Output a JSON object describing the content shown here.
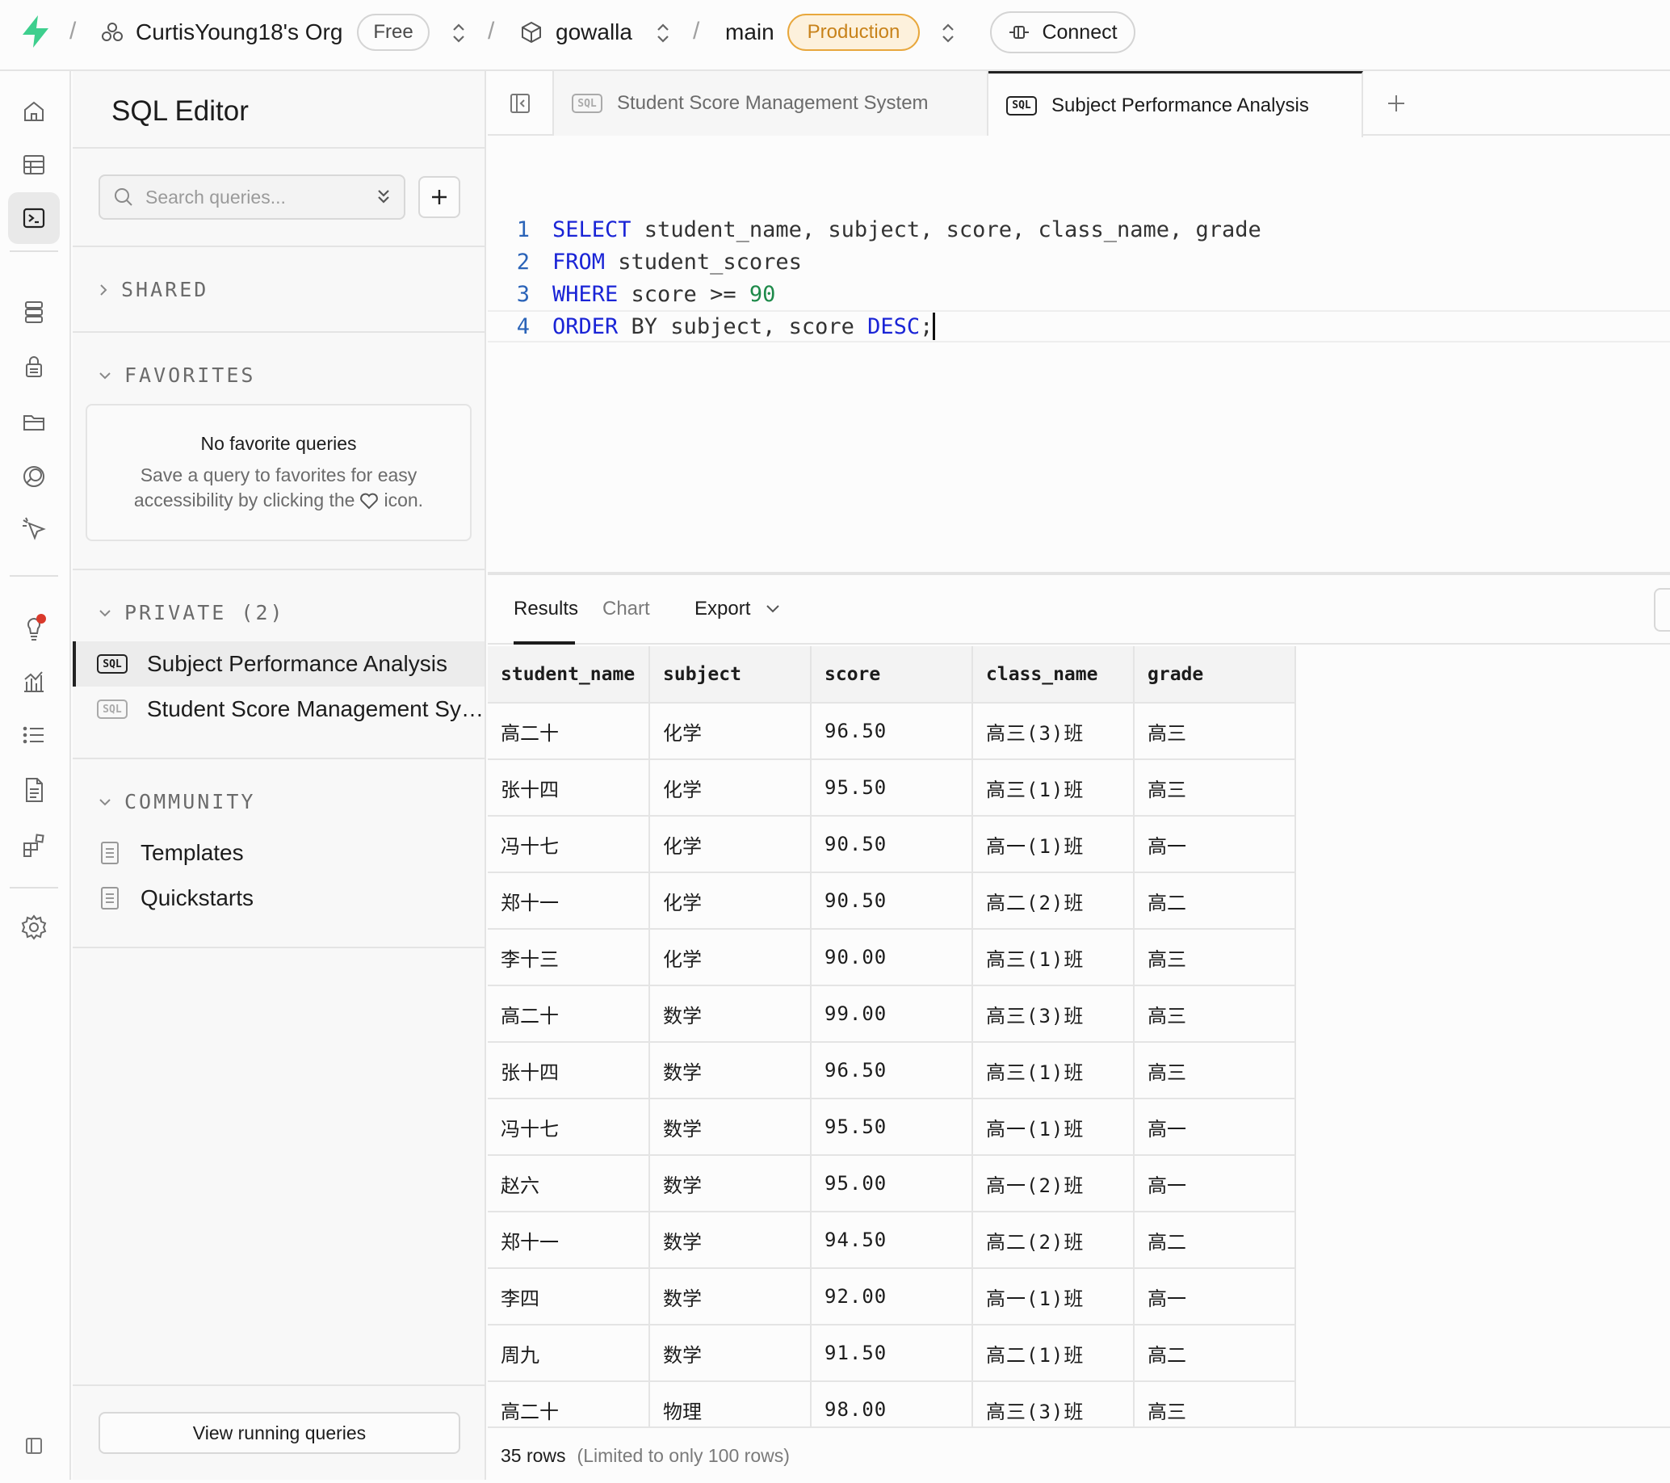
{
  "topbar": {
    "org_name": "CurtisYoung18's Org",
    "plan_badge": "Free",
    "project": "gowalla",
    "branch": "main",
    "env_badge": "Production",
    "connect_label": "Connect"
  },
  "sidebar": {
    "title": "SQL Editor",
    "search_placeholder": "Search queries...",
    "sections": {
      "shared": "SHARED",
      "favorites": "FAVORITES",
      "private": "PRIVATE (2)",
      "community": "COMMUNITY"
    },
    "favorites_empty": {
      "title": "No favorite queries",
      "line1": "Save a query to favorites for easy",
      "line2_a": "accessibility by clicking the",
      "line2_b": "icon."
    },
    "private_items": [
      {
        "label": "Subject Performance Analysis",
        "badge": "SQL"
      },
      {
        "label": "Student Score Management System",
        "badge": "SQL"
      }
    ],
    "community_items": [
      {
        "label": "Templates"
      },
      {
        "label": "Quickstarts"
      }
    ],
    "view_running": "View running queries"
  },
  "tabs": [
    {
      "label": "Student Score Management System",
      "badge": "SQL"
    },
    {
      "label": "Subject Performance Analysis",
      "badge": "SQL"
    }
  ],
  "editor": {
    "line_numbers": [
      "1",
      "2",
      "3",
      "4"
    ],
    "line1": {
      "kw": "SELECT",
      "rest": " student_name, subject, score, class_name, grade"
    },
    "line2": {
      "kw": "FROM",
      "rest": " student_scores"
    },
    "line3": {
      "kw": "WHERE",
      "rest": " score >= ",
      "num": "90"
    },
    "line4": {
      "kw": "ORDER",
      "rest": " BY subject, score ",
      "kw2": "DESC",
      "tail": ";"
    }
  },
  "results": {
    "tabs": {
      "results": "Results",
      "chart": "Chart",
      "export": "Export"
    },
    "columns": [
      "student_name",
      "subject",
      "score",
      "class_name",
      "grade"
    ],
    "rows": [
      [
        "高二十",
        "化学",
        "96.50",
        "高三(3)班",
        "高三"
      ],
      [
        "张十四",
        "化学",
        "95.50",
        "高三(1)班",
        "高三"
      ],
      [
        "冯十七",
        "化学",
        "90.50",
        "高一(1)班",
        "高一"
      ],
      [
        "郑十一",
        "化学",
        "90.50",
        "高二(2)班",
        "高二"
      ],
      [
        "李十三",
        "化学",
        "90.00",
        "高三(1)班",
        "高三"
      ],
      [
        "高二十",
        "数学",
        "99.00",
        "高三(3)班",
        "高三"
      ],
      [
        "张十四",
        "数学",
        "96.50",
        "高三(1)班",
        "高三"
      ],
      [
        "冯十七",
        "数学",
        "95.50",
        "高一(1)班",
        "高一"
      ],
      [
        "赵六",
        "数学",
        "95.00",
        "高一(2)班",
        "高一"
      ],
      [
        "郑十一",
        "数学",
        "94.50",
        "高二(2)班",
        "高二"
      ],
      [
        "李四",
        "数学",
        "92.00",
        "高一(1)班",
        "高一"
      ],
      [
        "周九",
        "数学",
        "91.50",
        "高二(1)班",
        "高二"
      ],
      [
        "高二十",
        "物理",
        "98.00",
        "高三(3)班",
        "高三"
      ]
    ],
    "row_count": "35 rows",
    "limit_note": "(Limited to only 100 rows)"
  },
  "colors": {
    "accent_green": "#3ecf8e",
    "production_bg": "#fdf1dc",
    "production_border": "#e8a73c",
    "production_text": "#c8821a"
  }
}
